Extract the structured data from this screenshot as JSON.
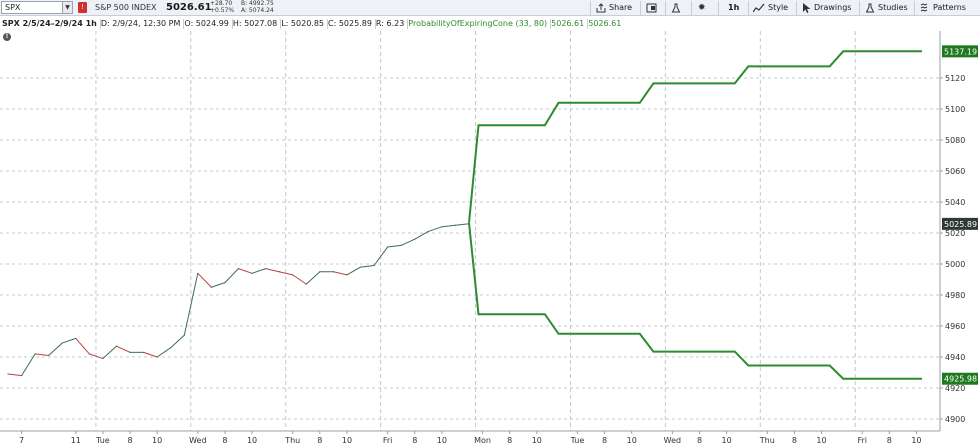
{
  "toolbar": {
    "symbol": "SPX",
    "index_name": "S&P 500 INDEX",
    "last": "5026.61",
    "change_abs": "+28.70",
    "change_pct": "+0.57%",
    "bid": "B: 4992.75",
    "ask": "A: 5074.24",
    "share_label": "Share",
    "interval_label": "1h",
    "style_label": "Style",
    "drawings_label": "Drawings",
    "studies_label": "Studies",
    "patterns_label": "Patterns"
  },
  "infobar": {
    "title": "SPX 2/5/24–2/9/24 1h",
    "date": "D: 2/9/24, 12:30 PM",
    "open": "O: 5024.99",
    "high": "H: 5027.08",
    "low": "L: 5020.85",
    "close": "C: 5025.89",
    "range": "R: 6.23",
    "study": "ProbabilityOfExpiringCone (33, 80)",
    "study_val1": "5026.61",
    "study_val2": "5026.61"
  },
  "colors": {
    "up": "#3d6b5e",
    "down": "#c04040",
    "cone": "#2e8b2e",
    "badge_green": "#1f7a1f",
    "badge_dark": "#2d3a33",
    "grid": "#c4c8cc"
  },
  "chart_data": {
    "type": "line",
    "y_ticks": [
      4900,
      4920,
      4940,
      4960,
      4980,
      5000,
      5020,
      5040,
      5060,
      5080,
      5100,
      5120
    ],
    "ylim": [
      4891,
      5149
    ],
    "x_ticks": [
      {
        "label": "7",
        "x": 1
      },
      {
        "label": "11",
        "x": 5
      },
      {
        "label": "Tue",
        "x": 7
      },
      {
        "label": "8",
        "x": 9
      },
      {
        "label": "10",
        "x": 11
      },
      {
        "label": "Wed",
        "x": 14
      },
      {
        "label": "8",
        "x": 16
      },
      {
        "label": "10",
        "x": 18
      },
      {
        "label": "Thu",
        "x": 21
      },
      {
        "label": "8",
        "x": 23
      },
      {
        "label": "10",
        "x": 25
      },
      {
        "label": "Fri",
        "x": 28
      },
      {
        "label": "8",
        "x": 30
      },
      {
        "label": "10",
        "x": 32
      },
      {
        "label": "Mon",
        "x": 35
      },
      {
        "label": "8",
        "x": 37
      },
      {
        "label": "10",
        "x": 39
      },
      {
        "label": "Tue",
        "x": 42
      },
      {
        "label": "8",
        "x": 44
      },
      {
        "label": "10",
        "x": 46
      },
      {
        "label": "Wed",
        "x": 49
      },
      {
        "label": "8",
        "x": 51
      },
      {
        "label": "10",
        "x": 53
      },
      {
        "label": "Thu",
        "x": 56
      },
      {
        "label": "8",
        "x": 58
      },
      {
        "label": "10",
        "x": 60
      },
      {
        "label": "Fri",
        "x": 63
      },
      {
        "label": "8",
        "x": 65
      },
      {
        "label": "10",
        "x": 67
      }
    ],
    "day_separators": [
      7,
      14,
      21,
      28,
      35,
      42,
      49,
      56,
      63
    ],
    "xlim": [
      0,
      68
    ],
    "series": [
      {
        "values": [
          [
            0,
            4929
          ],
          [
            1,
            4928
          ],
          [
            2,
            4942
          ],
          [
            3,
            4941
          ],
          [
            4,
            4949
          ],
          [
            5,
            4952
          ],
          [
            6,
            4942
          ],
          [
            7,
            4939
          ],
          [
            8,
            4947
          ],
          [
            9,
            4943
          ],
          [
            10,
            4943
          ],
          [
            11,
            4940
          ],
          [
            12,
            4946
          ],
          [
            13,
            4954
          ],
          [
            14,
            4994
          ],
          [
            15,
            4985
          ],
          [
            16,
            4988
          ],
          [
            17,
            4997
          ],
          [
            18,
            4994
          ],
          [
            19,
            4997
          ],
          [
            20,
            4995
          ],
          [
            21,
            4993
          ],
          [
            22,
            4987
          ],
          [
            23,
            4995
          ],
          [
            24,
            4995
          ],
          [
            25,
            4993
          ],
          [
            26,
            4998
          ],
          [
            27,
            4999
          ],
          [
            28,
            5011
          ],
          [
            29,
            5012
          ],
          [
            30,
            5016
          ],
          [
            31,
            5021
          ],
          [
            32,
            5024
          ],
          [
            33,
            5025
          ],
          [
            34,
            5026
          ]
        ]
      },
      {
        "values": [
          [
            34,
            5026.6
          ],
          [
            34.7,
            5089.5
          ],
          [
            39.6,
            5089.5
          ],
          [
            40.6,
            5104
          ],
          [
            46.6,
            5104
          ],
          [
            47.6,
            5116.5
          ],
          [
            53.6,
            5116.5
          ],
          [
            54.6,
            5127.5
          ],
          [
            60.6,
            5127.5
          ],
          [
            61.6,
            5137.2
          ],
          [
            67.4,
            5137.2
          ]
        ]
      },
      {
        "values": [
          [
            34,
            5026.6
          ],
          [
            34.7,
            4967.6
          ],
          [
            39.6,
            4967.6
          ],
          [
            40.6,
            4955
          ],
          [
            46.6,
            4955
          ],
          [
            47.6,
            4943.5
          ],
          [
            53.6,
            4943.5
          ],
          [
            54.6,
            4934.5
          ],
          [
            60.6,
            4934.5
          ],
          [
            61.6,
            4926
          ],
          [
            67.4,
            4926
          ]
        ]
      }
    ],
    "price_labels": [
      {
        "value": 5137.19,
        "text": "5137.19",
        "kind": "cone"
      },
      {
        "value": 5025.89,
        "text": "5025.89",
        "kind": "last"
      },
      {
        "value": 4925.98,
        "text": "4925.98",
        "kind": "cone"
      }
    ]
  }
}
